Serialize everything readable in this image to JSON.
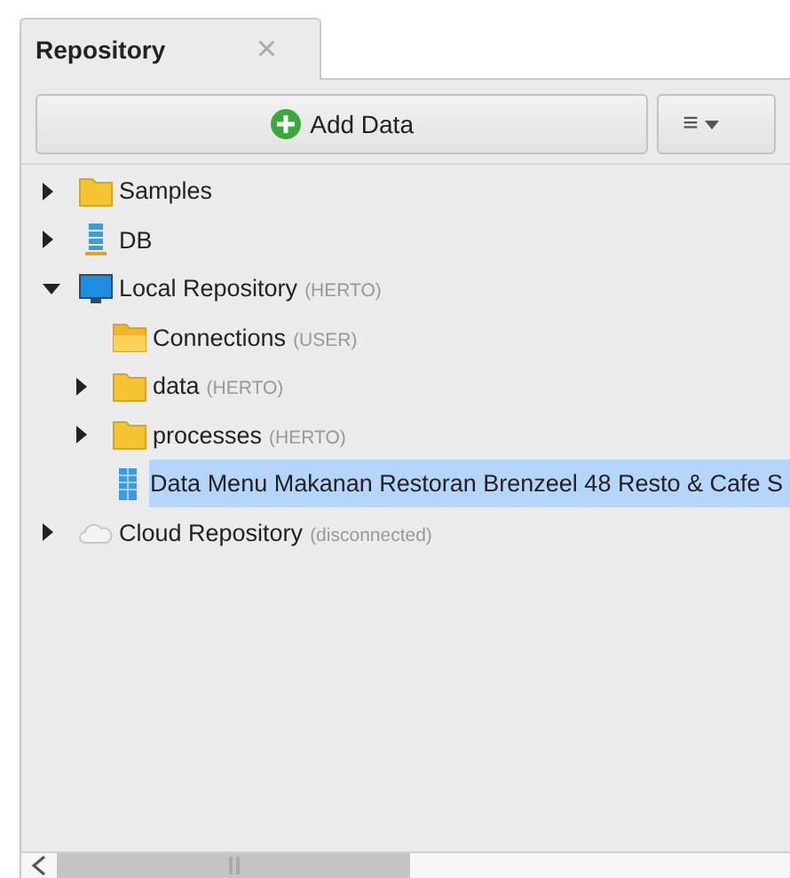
{
  "tab": {
    "label": "Repository",
    "close": "×",
    "selected": true
  },
  "toolbar": {
    "add_button": "Add Data",
    "menu_button": "≡"
  },
  "tree": [
    {
      "kind": "folder",
      "label": "Samples",
      "expanded": false,
      "selected": false
    },
    {
      "kind": "database",
      "label": "DB",
      "expanded": false,
      "selected": false
    },
    {
      "kind": "computer",
      "label": "Local Repository",
      "note": "(HERTO)",
      "expanded": true,
      "selected": false,
      "children": [
        {
          "kind": "folder-open",
          "label": "Connections",
          "note": "(USER)",
          "selected": false
        },
        {
          "kind": "folder",
          "label": "data",
          "note": "(HERTO)",
          "expanded": false,
          "selected": false
        },
        {
          "kind": "folder",
          "label": "processes",
          "note": "(HERTO)",
          "expanded": false,
          "selected": false
        },
        {
          "kind": "table",
          "label": "Data Menu Makanan Restoran Brenzeel 48 Resto & Cafe S",
          "selected": true
        }
      ]
    },
    {
      "kind": "cloud",
      "label": "Cloud Repository",
      "note": "(disconnected)",
      "expanded": false,
      "selected": false
    }
  ]
}
